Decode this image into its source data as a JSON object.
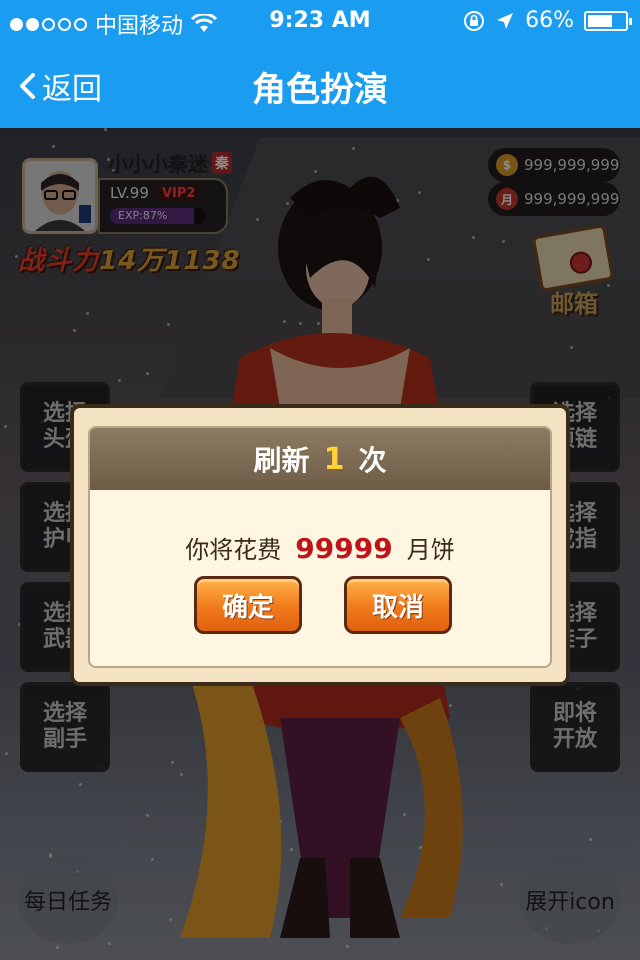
{
  "status_bar": {
    "carrier": "中国移动",
    "time": "9:23 AM",
    "battery_percent": "66%",
    "battery_level": 0.66,
    "signal_bars_filled": 2
  },
  "nav": {
    "back_label": "返回",
    "title": "角色扮演"
  },
  "player": {
    "name": "小小小秦迷",
    "faction_badge": "秦",
    "level": "LV.99",
    "vip": "VIP2",
    "exp_label": "EXP:87%",
    "exp_fraction": 0.87,
    "power_label": "战斗力",
    "power_value": "14万1138"
  },
  "currencies": [
    {
      "icon": "coin-icon",
      "symbol": "$",
      "value": "999,999,999",
      "color": "#d99a2a"
    },
    {
      "icon": "mooncake-icon",
      "symbol": "月",
      "value": "999,999,999",
      "color": "#c0392b"
    }
  ],
  "mail": {
    "label": "邮箱"
  },
  "left_buttons": [
    {
      "line1": "选择",
      "line2": "头盔"
    },
    {
      "line1": "选择",
      "line2": "护甲"
    },
    {
      "line1": "选择",
      "line2": "武器"
    },
    {
      "line1": "选择",
      "line2": "副手"
    }
  ],
  "right_buttons": [
    {
      "line1": "选择",
      "line2": "项链"
    },
    {
      "line1": "选择",
      "line2": "戒指"
    },
    {
      "line1": "选择",
      "line2": "鞋子"
    },
    {
      "line1": "即将",
      "line2": "开放"
    }
  ],
  "bottom": {
    "daily_tasks": "每日任务",
    "expand": "展开icon"
  },
  "dialog": {
    "title_prefix": "刷新",
    "title_count": "1",
    "title_suffix": "次",
    "msg_prefix": "你将花费",
    "msg_cost": "99999",
    "msg_suffix": "月饼",
    "confirm": "确定",
    "cancel": "取消"
  }
}
